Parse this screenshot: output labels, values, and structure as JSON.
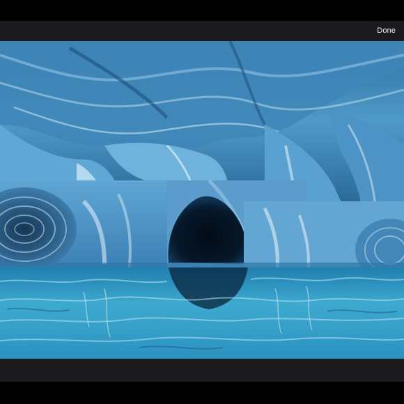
{
  "header": {
    "done_label": "Done"
  },
  "photo": {
    "subject": "photo-marble-cave"
  },
  "colors": {
    "bar": "#1b1b1d",
    "background": "#000000",
    "text": "#f2f2f7",
    "water": "#3aa6c9",
    "rock": "#4a86b8"
  }
}
